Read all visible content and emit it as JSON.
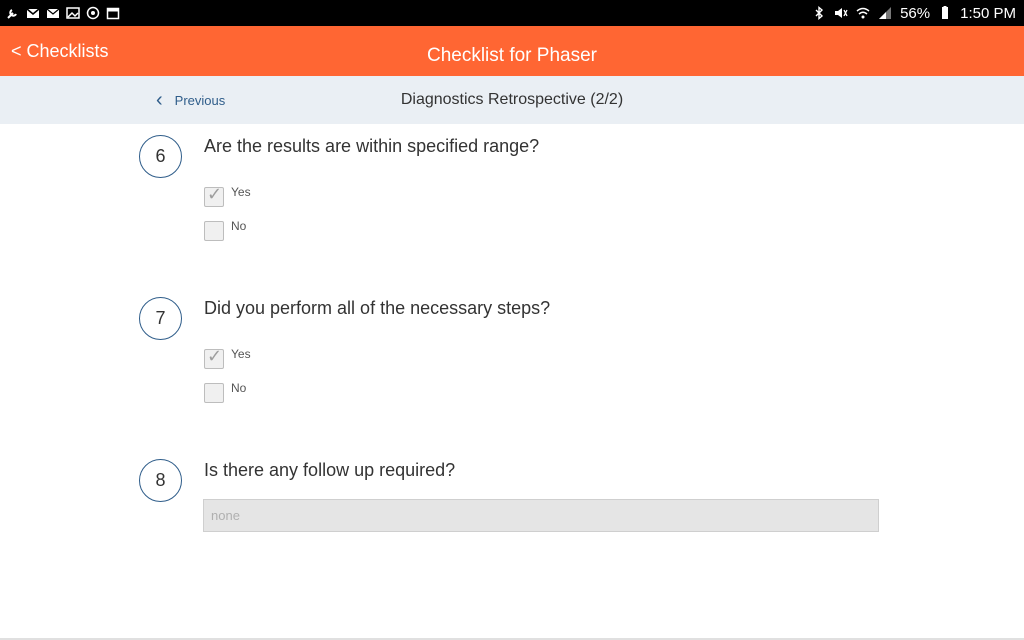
{
  "status_bar": {
    "battery": "56%",
    "time": "1:50 PM",
    "left_icons": [
      "wrench-icon",
      "gmail-icon",
      "email-icon",
      "image-icon",
      "sync-icon",
      "calendar-icon"
    ],
    "right_icons": [
      "bluetooth-icon",
      "mute-icon",
      "wifi-icon",
      "signal-icon",
      "battery-icon"
    ]
  },
  "app_bar": {
    "back_label": "< Checklists",
    "title": "Checklist for Phaser",
    "background": "#ff6633"
  },
  "sub_header": {
    "previous_label": "Previous",
    "section_title": "Diagnostics Retrospective (2/2)"
  },
  "questions": [
    {
      "number": "6",
      "text": "Are the results are within specified range?",
      "options": [
        {
          "label": "Yes",
          "checked": true
        },
        {
          "label": "No",
          "checked": false
        }
      ]
    },
    {
      "number": "7",
      "text": "Did you perform all of the necessary steps?",
      "options": [
        {
          "label": "Yes",
          "checked": true
        },
        {
          "label": "No",
          "checked": false
        }
      ]
    },
    {
      "number": "8",
      "text": "Is there any follow up required?",
      "input_placeholder": "none",
      "input_value": ""
    }
  ]
}
